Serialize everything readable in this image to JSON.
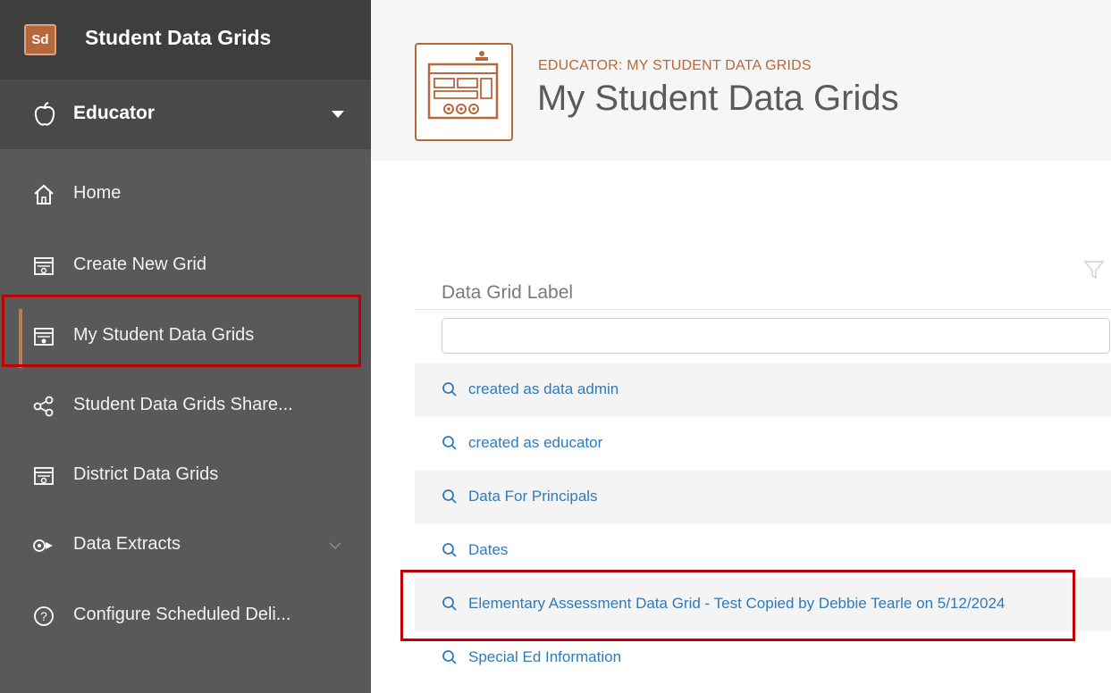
{
  "app": {
    "logo_text": "Sd",
    "title": "Student Data Grids"
  },
  "role": {
    "label": "Educator"
  },
  "nav": {
    "items": [
      {
        "label": "Home",
        "icon": "home-icon"
      },
      {
        "label": "Create New Grid",
        "icon": "grid-form-icon"
      },
      {
        "label": "My Student Data Grids",
        "icon": "grid-form-icon",
        "active": true
      },
      {
        "label": "Student Data Grids Share...",
        "icon": "share-icon"
      },
      {
        "label": "District Data Grids",
        "icon": "grid-form-icon"
      },
      {
        "label": "Data Extracts",
        "icon": "extract-icon"
      },
      {
        "label": "Configure Scheduled Deli...",
        "icon": "help-circle-icon"
      }
    ]
  },
  "page": {
    "breadcrumb": "EDUCATOR: MY STUDENT DATA GRIDS",
    "title": "My Student Data Grids"
  },
  "table": {
    "column_header": "Data Grid Label",
    "filter_value": "",
    "rows": [
      "created as data admin",
      "created as educator",
      "Data For Principals",
      "Dates",
      "Elementary Assessment Data Grid - Test Copied by Debbie Tearle on 5/12/2024",
      "Special Ed Information"
    ]
  },
  "colors": {
    "sidebar_bg": "#58595b",
    "accent": "#b7683a",
    "link": "#2f7ab8",
    "highlight": "#c00000"
  }
}
